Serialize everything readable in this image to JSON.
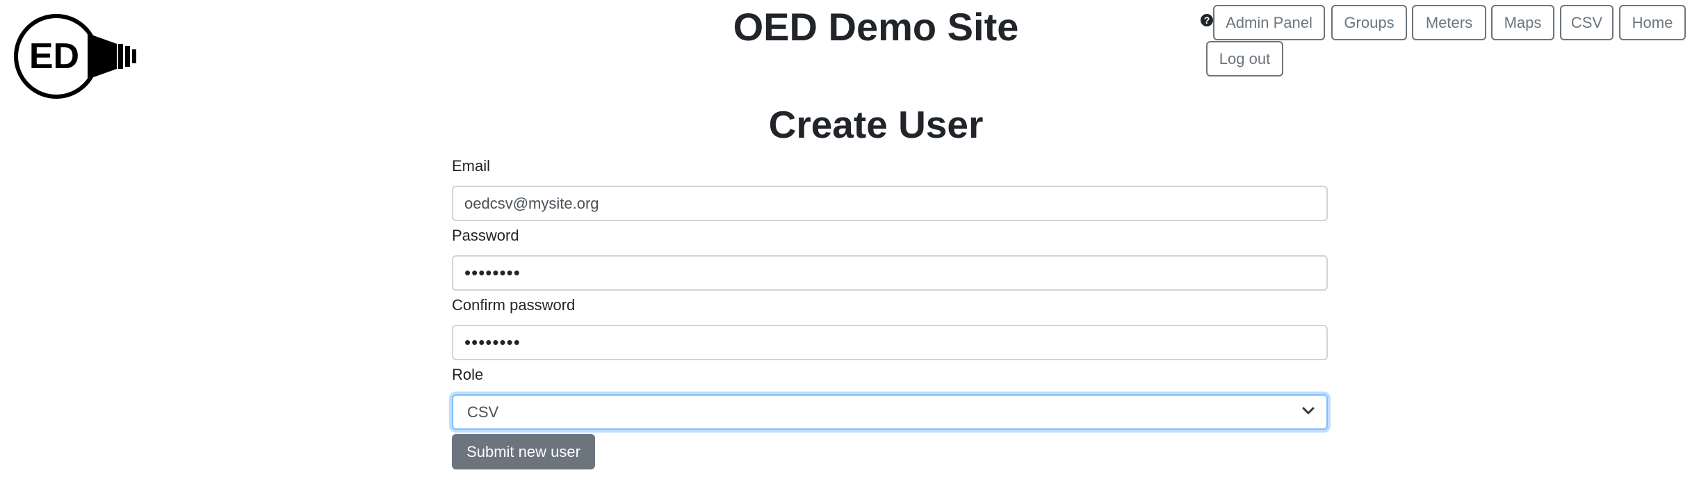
{
  "logo": {
    "text": "ED",
    "icon": "oed-lightbulb-logo"
  },
  "header": {
    "title": "OED Demo Site"
  },
  "nav": {
    "help_icon": "question-circle-icon",
    "help_glyph": "?",
    "buttons": {
      "admin_panel": "Admin Panel",
      "groups": "Groups",
      "meters": "Meters",
      "maps": "Maps",
      "csv": "CSV",
      "home": "Home",
      "log_out": "Log out"
    }
  },
  "page": {
    "heading": "Create User"
  },
  "form": {
    "email": {
      "label": "Email",
      "value": "oedcsv@mysite.org"
    },
    "password": {
      "label": "Password",
      "value": "••••••••"
    },
    "confirm_password": {
      "label": "Confirm password",
      "value": "••••••••"
    },
    "role": {
      "label": "Role",
      "selected": "CSV"
    },
    "submit_label": "Submit new user"
  },
  "colors": {
    "outline_button": "#6c757d",
    "focus_border": "#80bdff",
    "submit_bg": "#6c757d"
  }
}
